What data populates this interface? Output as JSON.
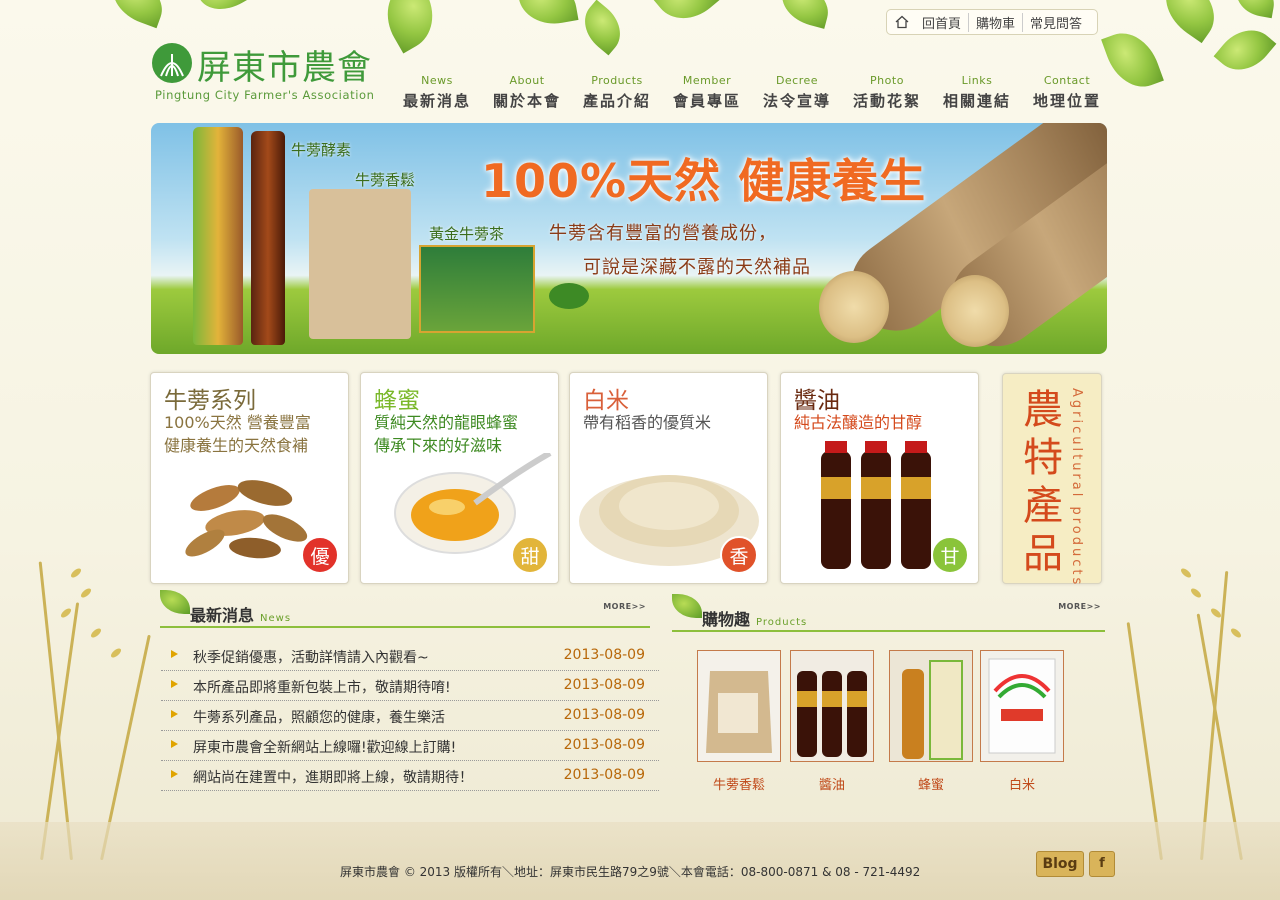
{
  "toplinks": {
    "home": "回首頁",
    "cart": "購物車",
    "faq": "常見問答"
  },
  "logo": {
    "name": "屏東市農會",
    "subtitle": "Pingtung City Farmer's Association"
  },
  "nav": [
    {
      "en": "News",
      "zh": "最新消息"
    },
    {
      "en": "About",
      "zh": "關於本會"
    },
    {
      "en": "Products",
      "zh": "產品介紹"
    },
    {
      "en": "Member",
      "zh": "會員專區"
    },
    {
      "en": "Decree",
      "zh": "法令宣導"
    },
    {
      "en": "Photo",
      "zh": "活動花絮"
    },
    {
      "en": "Links",
      "zh": "相關連結"
    },
    {
      "en": "Contact",
      "zh": "地理位置"
    }
  ],
  "banner": {
    "headline": "100%天然 健康養生",
    "line1": "牛蒡含有豐富的營養成份，",
    "line2": "可說是深藏不露的天然補品",
    "labels": [
      "牛蒡酵素",
      "牛蒡香鬆",
      "黃金牛蒡茶"
    ]
  },
  "cards": [
    {
      "title": "牛蒡系列",
      "desc1": "100%天然 營養豐富",
      "desc2": "健康養生的天然食補",
      "badge": "優",
      "title_color": "#7a6a3a",
      "desc_color": "#8a7440",
      "badge_color": "#e2322a"
    },
    {
      "title": "蜂蜜",
      "desc1": "質純天然的龍眼蜂蜜",
      "desc2": "傳承下來的好滋味",
      "badge": "甜",
      "title_color": "#7ab82a",
      "desc_color": "#3e8a22",
      "badge_color": "#e2b53a"
    },
    {
      "title": "白米",
      "desc1": "帶有稻香的優質米",
      "desc2": "",
      "badge": "香",
      "title_color": "#d9603a",
      "desc_color": "#555555",
      "badge_color": "#e0522a"
    },
    {
      "title": "醬油",
      "desc1": "純古法釀造的甘醇",
      "desc2": "",
      "badge": "甘",
      "title_color": "#6a2a10",
      "desc_color": "#d44a1c",
      "badge_color": "#8ac43a"
    }
  ],
  "agri": {
    "zh": "農特產品",
    "en": "Agricultural products"
  },
  "news": {
    "title": "最新消息",
    "title_en": "News",
    "more": "MORE>>",
    "items": [
      {
        "text": "秋季促銷優惠，活動詳情請入內觀看~",
        "date": "2013-08-09"
      },
      {
        "text": "本所產品即將重新包裝上市，敬請期待唷!",
        "date": "2013-08-09"
      },
      {
        "text": "牛蒡系列產品，照顧您的健康，養生樂活",
        "date": "2013-08-09"
      },
      {
        "text": "屏東市農會全新網站上線囉!歡迎線上訂購!",
        "date": "2013-08-09"
      },
      {
        "text": "網站尚在建置中，進期即將上線，敬請期待！",
        "date": "2013-08-09"
      }
    ]
  },
  "shop": {
    "title": "購物趣",
    "title_en": "Products",
    "more": "MORE>>",
    "items": [
      {
        "name": "牛蒡香鬆"
      },
      {
        "name": "醬油"
      },
      {
        "name": "蜂蜜"
      },
      {
        "name": "白米"
      }
    ]
  },
  "footer": {
    "text": "屏東市農會 © 2013 版權所有＼地址：屏東市民生路79之9號＼本會電話：08-800-0871 & 08 - 721-4492",
    "blog": "Blog",
    "fb": "f"
  }
}
